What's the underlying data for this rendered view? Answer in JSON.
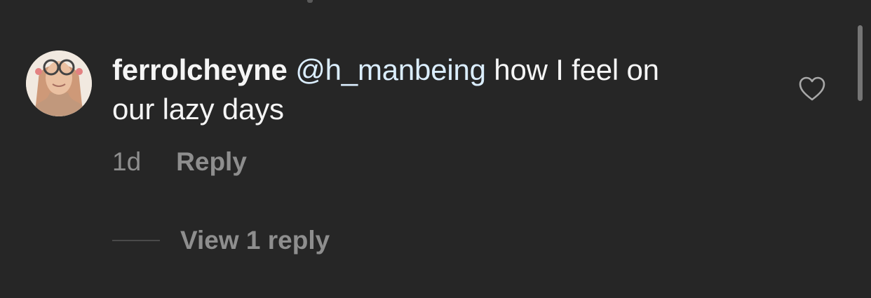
{
  "comment": {
    "username": "ferrolcheyne",
    "mention": "@h_manbeing",
    "text_part1": " how I feel on",
    "text_part2": "our lazy days",
    "time": "1d",
    "reply_label": "Reply",
    "view_replies_label": "View 1 reply",
    "like_icon": "heart-outline"
  },
  "colors": {
    "background": "#262626",
    "primary_text": "#f5f5f5",
    "mention": "#dbeeff",
    "secondary_text": "#8e8e8e"
  }
}
